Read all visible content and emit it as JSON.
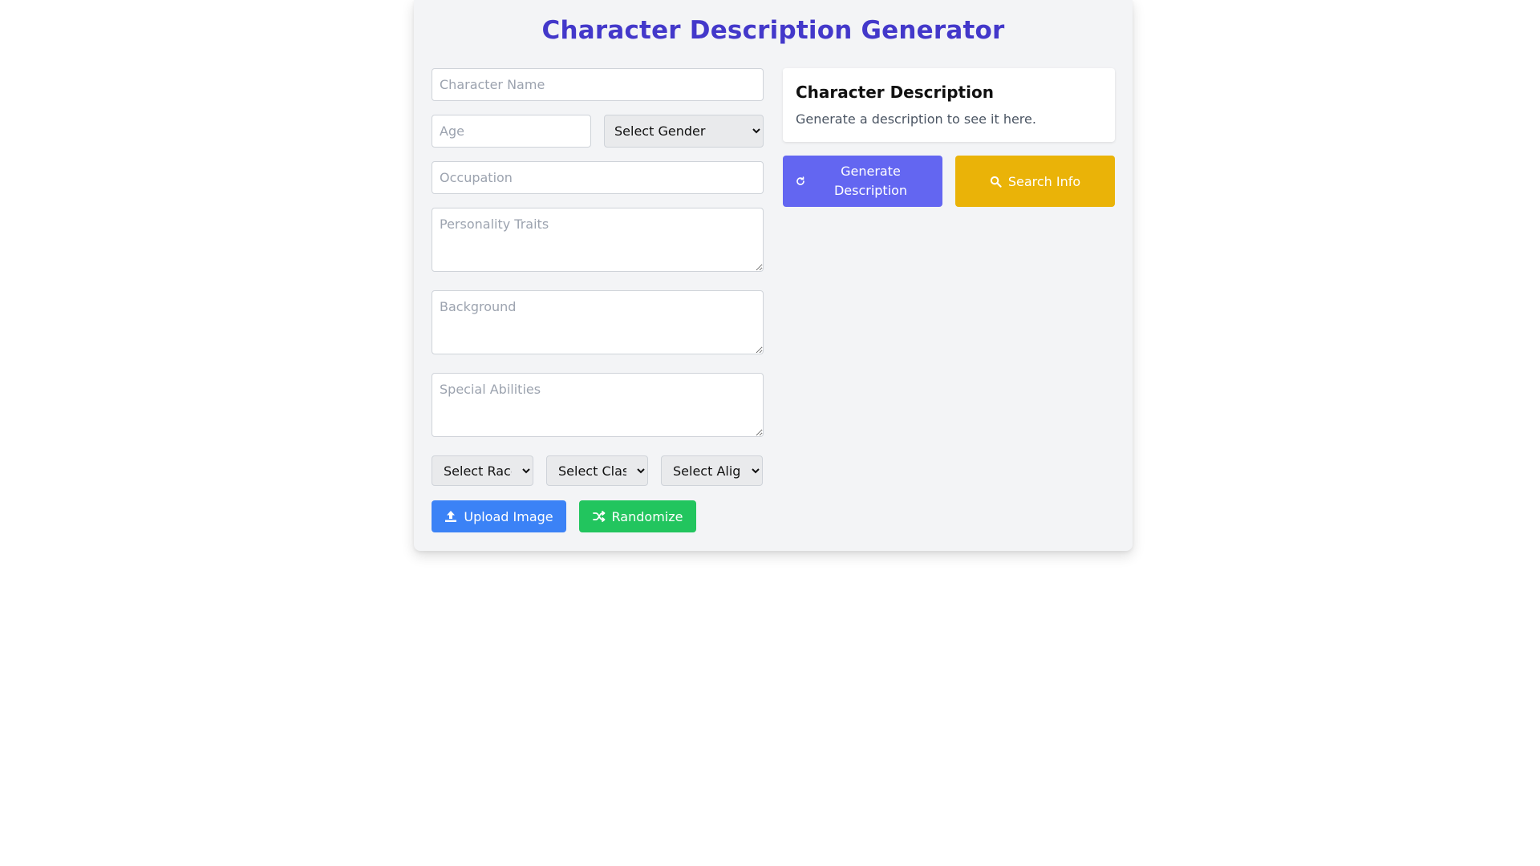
{
  "header": {
    "title": "Character Description Generator"
  },
  "form": {
    "name_placeholder": "Character Name",
    "age_placeholder": "Age",
    "gender_select": "Select Gender",
    "occupation_placeholder": "Occupation",
    "personality_placeholder": "Personality Traits",
    "background_placeholder": "Background",
    "abilities_placeholder": "Special Abilities",
    "race_select": "Select Race",
    "class_select": "Select Class",
    "alignment_select": "Select Alignment"
  },
  "actions": {
    "upload_label": "Upload Image",
    "upload_icon": "upload-icon",
    "randomize_label": "Randomize",
    "randomize_icon": "shuffle-icon",
    "generate_label": "Generate Description",
    "generate_icon": "refresh-icon",
    "search_label": "Search Info",
    "search_icon": "search-icon"
  },
  "output": {
    "title": "Character Description",
    "text": "Generate a description to see it here."
  },
  "colors": {
    "title": "#4338ca",
    "upload": "#3b82f6",
    "randomize": "#22c55e",
    "generate": "#6366f1",
    "search": "#eab308",
    "panel_bg": "#f3f4f6"
  }
}
